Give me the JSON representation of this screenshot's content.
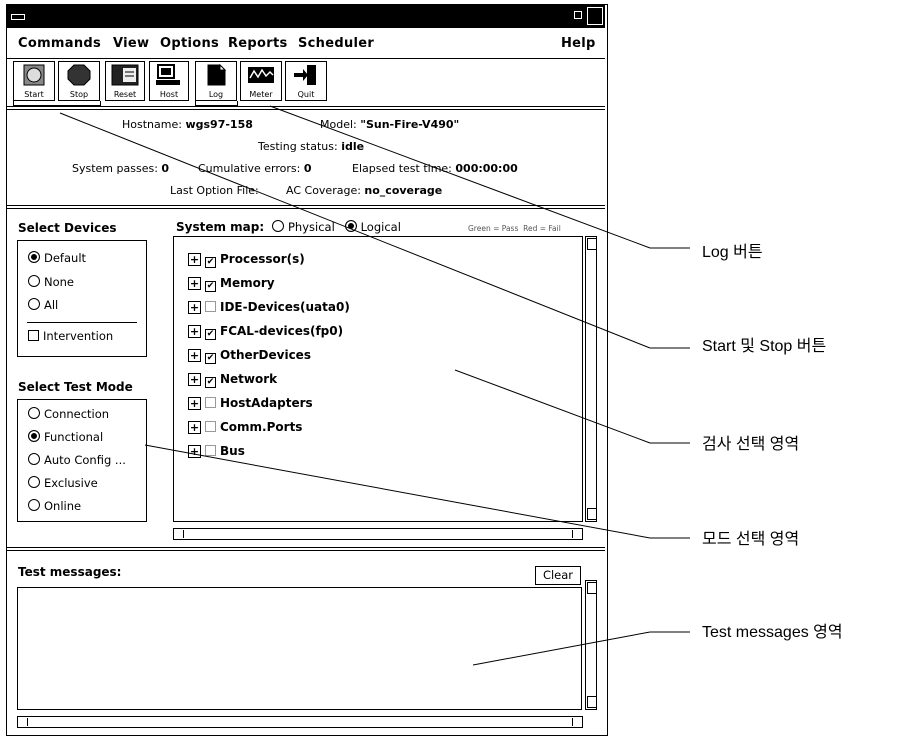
{
  "menubar": {
    "items": [
      "Commands",
      "View",
      "Options",
      "Reports",
      "Scheduler"
    ],
    "help": "Help"
  },
  "toolbar": [
    {
      "label": "Start",
      "icon": "start-icon"
    },
    {
      "label": "Stop",
      "icon": "stop-icon"
    },
    {
      "label": "Reset",
      "icon": "reset-icon"
    },
    {
      "label": "Host",
      "icon": "host-icon"
    },
    {
      "label": "Log",
      "icon": "log-icon"
    },
    {
      "label": "Meter",
      "icon": "meter-icon"
    },
    {
      "label": "Quit",
      "icon": "quit-icon"
    }
  ],
  "status": {
    "hostname_label": "Hostname:",
    "hostname_value": "wgs97-158",
    "model_label": "Model:",
    "model_value": "\"Sun-Fire-V490\"",
    "testing_status_label": "Testing status:",
    "testing_status_value": "idle",
    "system_passes_label": "System passes:",
    "system_passes_value": "0",
    "cumulative_errors_label": "Cumulative errors:",
    "cumulative_errors_value": "0",
    "elapsed_label": "Elapsed test time:",
    "elapsed_value": "000:00:00",
    "last_option_label": "Last Option File:",
    "ac_coverage_label": "AC Coverage:",
    "ac_coverage_value": "no_coverage"
  },
  "select_devices": {
    "title": "Select Devices",
    "options": [
      "Default",
      "None",
      "All"
    ],
    "selected": "Default",
    "intervention": "Intervention"
  },
  "select_test_mode": {
    "title": "Select Test Mode",
    "options": [
      "Connection",
      "Functional",
      "Auto Config ...",
      "Exclusive",
      "Online"
    ],
    "selected": "Functional"
  },
  "system_map": {
    "label": "System map:",
    "options": [
      "Physical",
      "Logical"
    ],
    "selected": "Logical",
    "legend": "Green = Pass  Red = Fail",
    "devices": [
      {
        "name": "Processor(s)",
        "checked": true
      },
      {
        "name": "Memory",
        "checked": true
      },
      {
        "name": "IDE-Devices(uata0)",
        "checked": false
      },
      {
        "name": "FCAL-devices(fp0)",
        "checked": true
      },
      {
        "name": "OtherDevices",
        "checked": true
      },
      {
        "name": "Network",
        "checked": true
      },
      {
        "name": "HostAdapters",
        "checked": false
      },
      {
        "name": "Comm.Ports",
        "checked": false
      },
      {
        "name": "Bus",
        "checked": false
      }
    ]
  },
  "messages": {
    "title": "Test messages:",
    "clear": "Clear"
  },
  "annotations": {
    "log": "Log 버튼",
    "start_stop": "Start 및 Stop 버튼",
    "test_select": "검사 선택 영역",
    "mode_select": "모드 선택 영역",
    "test_messages": "Test messages 영역"
  }
}
